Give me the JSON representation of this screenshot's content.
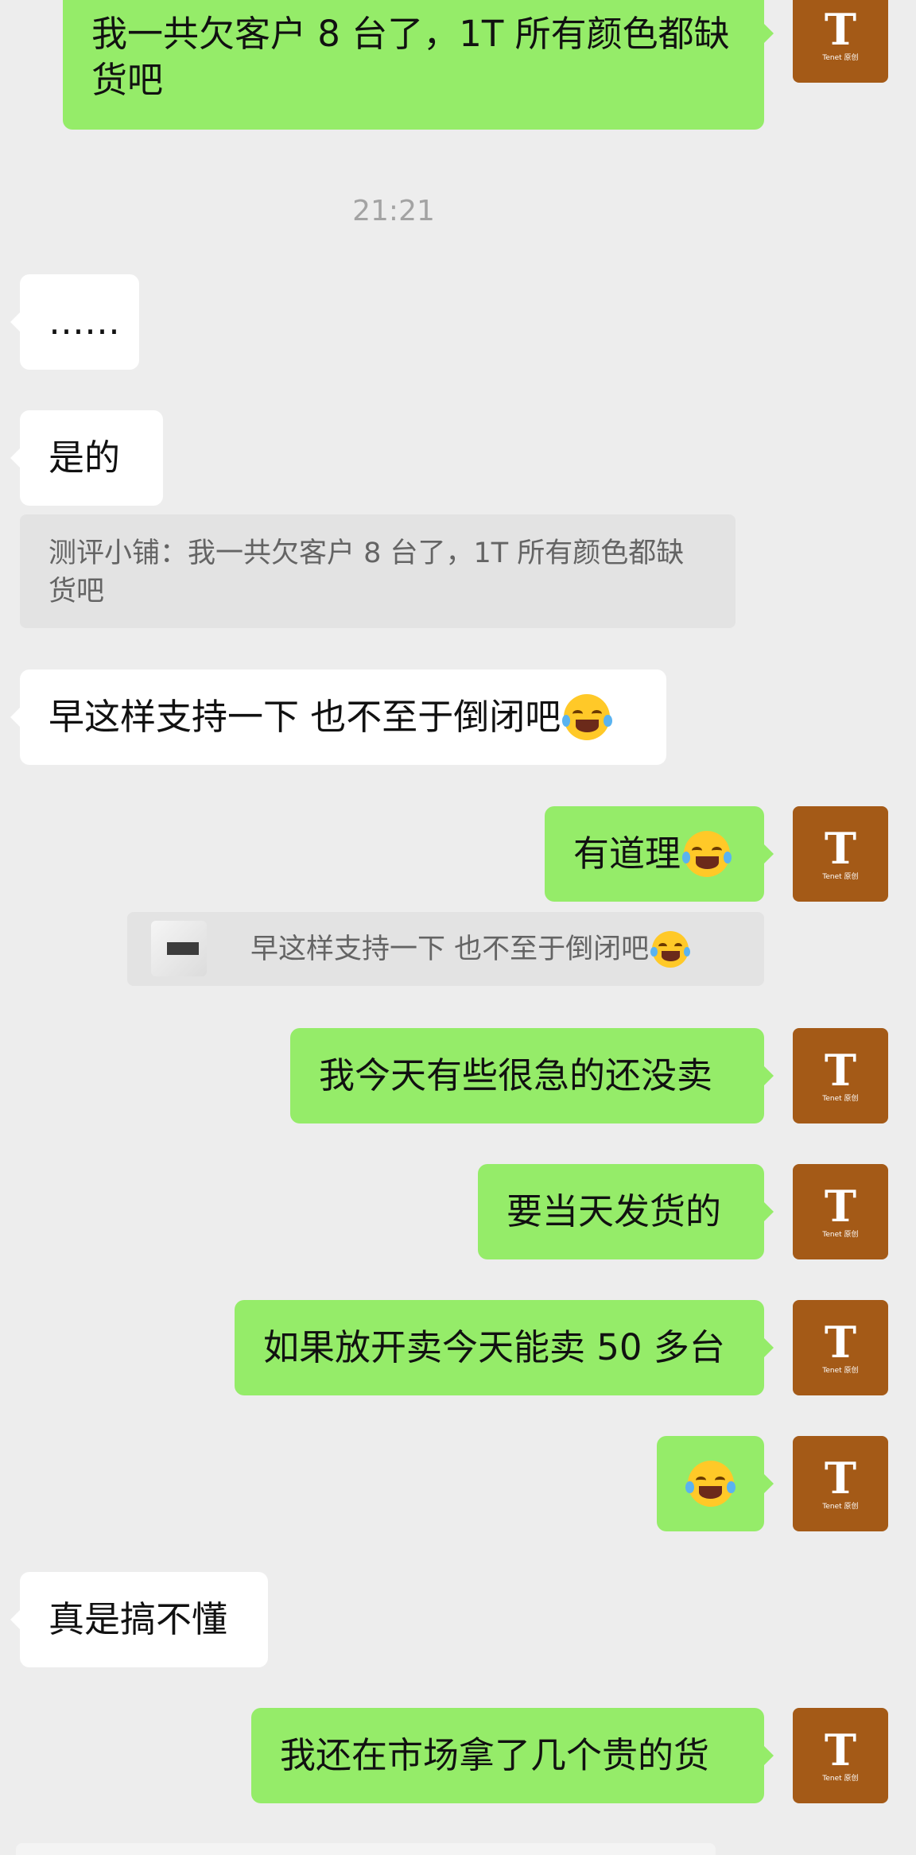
{
  "conversation": {
    "timestamp": "21:21",
    "messages": {
      "m1": "我一共欠客户 8 台了，1T 所有颜色都缺货吧",
      "m2": "……",
      "m3": "是的",
      "m3_quote": "测评小铺：我一共欠客户 8 台了，1T 所有颜色都缺货吧",
      "m4": "早这样支持一下 也不至于倒闭吧",
      "m5": "有道理",
      "m5_quote": "早这样支持一下 也不至于倒闭吧",
      "m6": "我今天有些很急的还没卖",
      "m7": "要当天发货的",
      "m8": "如果放开卖今天能卖 50 多台",
      "m10": "真是搞不懂",
      "m11": "我还在市场拿了几个贵的货"
    },
    "avatar": {
      "letter": "T",
      "caption": "Tenet 原创"
    },
    "colors": {
      "outgoing_bubble": "#95ec69",
      "incoming_bubble": "#ffffff",
      "background": "#ededed",
      "avatar": "#a45a17"
    },
    "emoji_icons": [
      "laughing-tears-emoji",
      "facepalm-laughing-emoji"
    ]
  }
}
